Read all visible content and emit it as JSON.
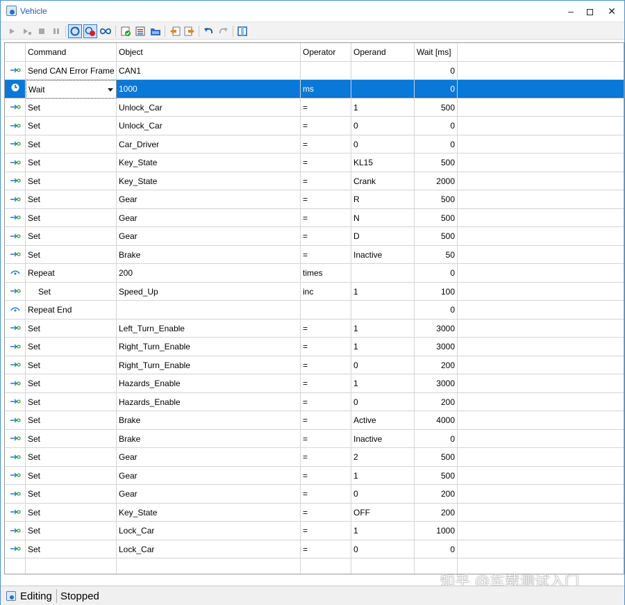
{
  "window": {
    "title": "Vehicle",
    "minimize_label": "–",
    "close_label": "✕"
  },
  "colors": {
    "selection": "#0a78d7",
    "title_text": "#1a5fb4",
    "grid_line": "#d4d4d4"
  },
  "toolbar": {
    "buttons": [
      {
        "name": "run-icon"
      },
      {
        "name": "step-icon"
      },
      {
        "name": "stop-icon"
      },
      {
        "name": "pause-icon"
      },
      {
        "name": "loop-icon"
      },
      {
        "name": "record-icon"
      },
      {
        "name": "infinite-loop-icon"
      },
      {
        "name": "check-icon"
      },
      {
        "name": "list-icon"
      },
      {
        "name": "folder-icon"
      },
      {
        "name": "import-icon"
      },
      {
        "name": "export-icon"
      },
      {
        "name": "undo-icon"
      },
      {
        "name": "redo-icon"
      },
      {
        "name": "panel-icon"
      }
    ]
  },
  "table": {
    "columns": {
      "command": "Command",
      "object": "Object",
      "operator": "Operator",
      "operand": "Operand",
      "wait": "Wait [ms]"
    },
    "rows": [
      {
        "icon": "set-icon",
        "command": "Send CAN Error Frame",
        "object": "CAN1",
        "operator": "",
        "operand": "",
        "wait": "0"
      },
      {
        "icon": "wait-icon",
        "command": "Wait",
        "object": "1000",
        "operator": "ms",
        "operand": "",
        "wait": "0"
      },
      {
        "icon": "set-icon",
        "command": "Set",
        "object": "Unlock_Car",
        "operator": "=",
        "operand": "1",
        "wait": "500"
      },
      {
        "icon": "set-icon",
        "command": "Set",
        "object": "Unlock_Car",
        "operator": "=",
        "operand": "0",
        "wait": "0"
      },
      {
        "icon": "set-icon",
        "command": "Set",
        "object": "Car_Driver",
        "operator": "=",
        "operand": "0",
        "wait": "0"
      },
      {
        "icon": "set-icon",
        "command": "Set",
        "object": "Key_State",
        "operator": "=",
        "operand": "KL15",
        "wait": "500"
      },
      {
        "icon": "set-icon",
        "command": "Set",
        "object": "Key_State",
        "operator": "=",
        "operand": "Crank",
        "wait": "2000"
      },
      {
        "icon": "set-icon",
        "command": "Set",
        "object": "Gear",
        "operator": "=",
        "operand": "R",
        "wait": "500"
      },
      {
        "icon": "set-icon",
        "command": "Set",
        "object": "Gear",
        "operator": "=",
        "operand": "N",
        "wait": "500"
      },
      {
        "icon": "set-icon",
        "command": "Set",
        "object": "Gear",
        "operator": "=",
        "operand": "D",
        "wait": "500"
      },
      {
        "icon": "set-icon",
        "command": "Set",
        "object": "Brake",
        "operator": "=",
        "operand": "Inactive",
        "wait": "50"
      },
      {
        "icon": "repeat-icon",
        "command": "Repeat",
        "object": "200",
        "operator": "times",
        "operand": "",
        "wait": "0"
      },
      {
        "icon": "set-icon",
        "command": "Set",
        "object": "Speed_Up",
        "operator": "inc",
        "operand": "1",
        "wait": "100",
        "indent": true
      },
      {
        "icon": "repeat-icon",
        "command": "Repeat End",
        "object": "",
        "operator": "",
        "operand": "",
        "wait": "0"
      },
      {
        "icon": "set-icon",
        "command": "Set",
        "object": "Left_Turn_Enable",
        "operator": "=",
        "operand": "1",
        "wait": "3000"
      },
      {
        "icon": "set-icon",
        "command": "Set",
        "object": "Right_Turn_Enable",
        "operator": "=",
        "operand": "1",
        "wait": "3000"
      },
      {
        "icon": "set-icon",
        "command": "Set",
        "object": "Right_Turn_Enable",
        "operator": "=",
        "operand": "0",
        "wait": "200"
      },
      {
        "icon": "set-icon",
        "command": "Set",
        "object": "Hazards_Enable",
        "operator": "=",
        "operand": "1",
        "wait": "3000"
      },
      {
        "icon": "set-icon",
        "command": "Set",
        "object": "Hazards_Enable",
        "operator": "=",
        "operand": "0",
        "wait": "200"
      },
      {
        "icon": "set-icon",
        "command": "Set",
        "object": "Brake",
        "operator": "=",
        "operand": "Active",
        "wait": "4000"
      },
      {
        "icon": "set-icon",
        "command": "Set",
        "object": "Brake",
        "operator": "=",
        "operand": "Inactive",
        "wait": "0"
      },
      {
        "icon": "set-icon",
        "command": "Set",
        "object": "Gear",
        "operator": "=",
        "operand": "2",
        "wait": "500"
      },
      {
        "icon": "set-icon",
        "command": "Set",
        "object": "Gear",
        "operator": "=",
        "operand": "1",
        "wait": "500"
      },
      {
        "icon": "set-icon",
        "command": "Set",
        "object": "Gear",
        "operator": "=",
        "operand": "0",
        "wait": "200"
      },
      {
        "icon": "set-icon",
        "command": "Set",
        "object": "Key_State",
        "operator": "=",
        "operand": "OFF",
        "wait": "200"
      },
      {
        "icon": "set-icon",
        "command": "Set",
        "object": "Lock_Car",
        "operator": "=",
        "operand": "1",
        "wait": "1000"
      },
      {
        "icon": "set-icon",
        "command": "Set",
        "object": "Lock_Car",
        "operator": "=",
        "operand": "0",
        "wait": "0"
      }
    ],
    "selected_index": 1
  },
  "statusbar": {
    "mode": "Editing",
    "state": "Stopped"
  },
  "watermark": "知乎 @车载测试入门"
}
